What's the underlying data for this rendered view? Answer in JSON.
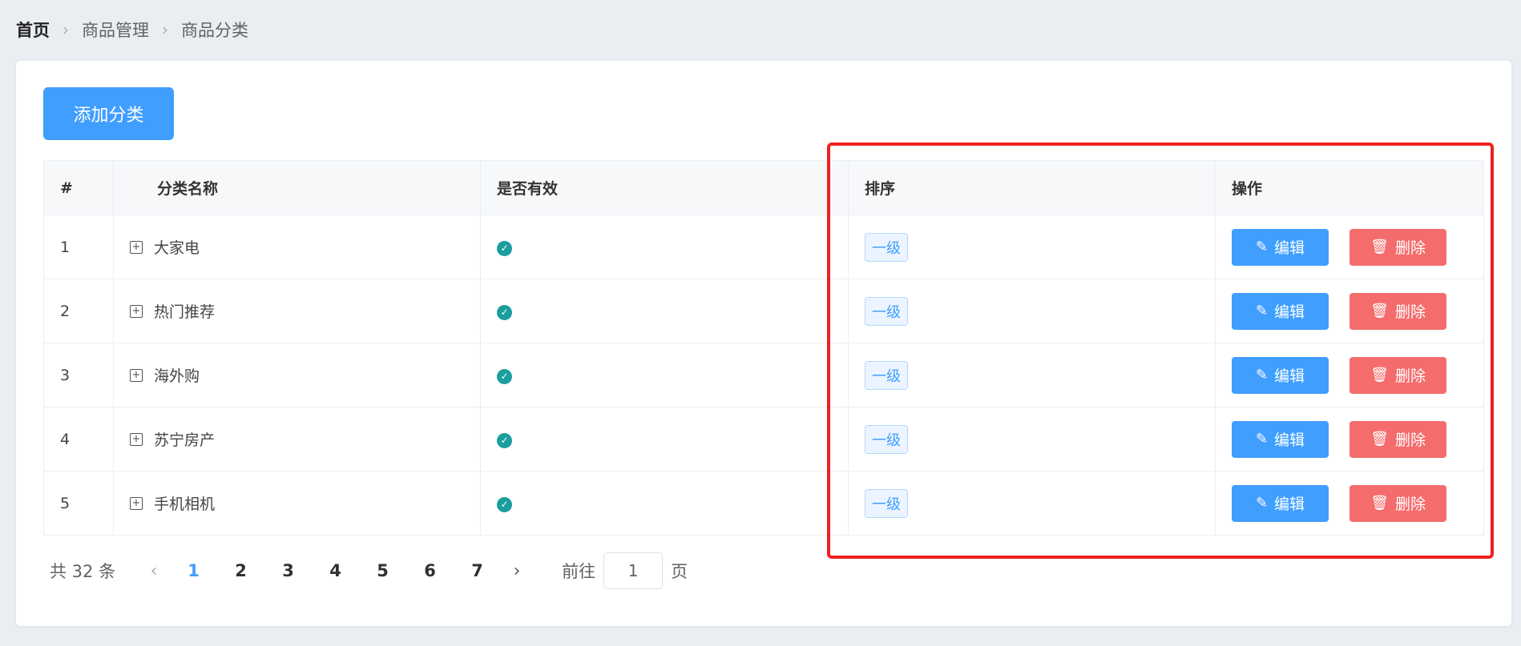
{
  "breadcrumb": [
    "首页",
    "商品管理",
    "商品分类"
  ],
  "add_button": "添加分类",
  "table": {
    "headers": [
      "#",
      "分类名称",
      "是否有效",
      "排序",
      "操作"
    ],
    "rows": [
      {
        "idx": "1",
        "name": "大家电",
        "level": "一级"
      },
      {
        "idx": "2",
        "name": "热门推荐",
        "level": "一级"
      },
      {
        "idx": "3",
        "name": "海外购",
        "level": "一级"
      },
      {
        "idx": "4",
        "name": "苏宁房产",
        "level": "一级"
      },
      {
        "idx": "5",
        "name": "手机相机",
        "level": "一级"
      }
    ],
    "edit_label": "编辑",
    "delete_label": "删除"
  },
  "pagination": {
    "total": "共 32 条",
    "pages": [
      "1",
      "2",
      "3",
      "4",
      "5",
      "6",
      "7"
    ],
    "current": "1",
    "goto_prefix": "前往",
    "goto_value": "1",
    "goto_suffix": "页"
  },
  "colors": {
    "primary": "#409eff",
    "danger": "#f56c6c",
    "success": "#1a9e9e",
    "highlight": "#f02020"
  }
}
